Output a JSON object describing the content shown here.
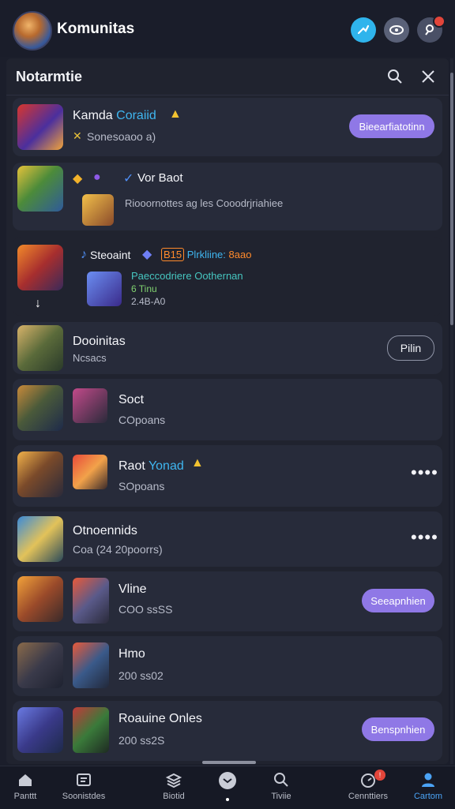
{
  "header": {
    "title": "Komunitas",
    "icons": [
      "profile-avatar",
      "share-icon",
      "eye-icon",
      "user-search-icon"
    ]
  },
  "panel": {
    "title": "Notarmtie",
    "search_icon": "search-icon",
    "close_icon": "close-icon"
  },
  "cards": [
    {
      "title_plain": "Kamda ",
      "title_accent": "Coraiid",
      "subtitle": "Sonesoaoo a)",
      "button": "Bieearfiatotinn"
    },
    {
      "title": "Vor Baot",
      "subtitle": "Riooornottes ag les Cooodrjriahiee"
    },
    {
      "title_plain": "Steoaint",
      "title_badge": "B15",
      "title_accent": "Plrkliine:",
      "title_tail": "8aao",
      "subtitle_accent": "Paeccodriere Oothernan",
      "subtitle_line2": "6 Tinu",
      "subtitle_line3": "2.4B-A0"
    },
    {
      "title": "Dooinitas",
      "subtitle": "Ncsacs",
      "button": "Pilin"
    },
    {
      "title": "Soct",
      "subtitle": "COpoans"
    },
    {
      "title_plain": "Raot ",
      "title_accent": "Yonad",
      "subtitle": "SOpoans"
    },
    {
      "title": "Otnoennids",
      "subtitle": "Coa (24 20poorrs)"
    },
    {
      "title": "Vline",
      "subtitle": "COO ssSS",
      "button": "Seeapnhien"
    },
    {
      "title": "Hmo",
      "subtitle": "200 ss02"
    },
    {
      "title": "Roauine Onles",
      "subtitle": "200 ss2S",
      "button": "Benspnhien"
    }
  ],
  "more_glyph": "••••",
  "nav": [
    {
      "label": "Panttt",
      "icon": "home-icon"
    },
    {
      "label": "Soonistdes",
      "icon": "news-icon"
    },
    {
      "label": "Biotid",
      "icon": "layers-icon"
    },
    {
      "label": "",
      "icon": "game-controller-icon"
    },
    {
      "label": "Tiviie",
      "icon": "search-icon"
    },
    {
      "label": "Cennttiers",
      "icon": "notification-icon",
      "badge": "!"
    },
    {
      "label": "Cartom",
      "icon": "profile-icon",
      "active": true
    }
  ],
  "colors": {
    "background": "#1b1e2b",
    "card": "#272b3a",
    "accent_purple": "#8f78e6",
    "accent_blue": "#3fb6f0",
    "active_nav": "#4ba3f5"
  }
}
